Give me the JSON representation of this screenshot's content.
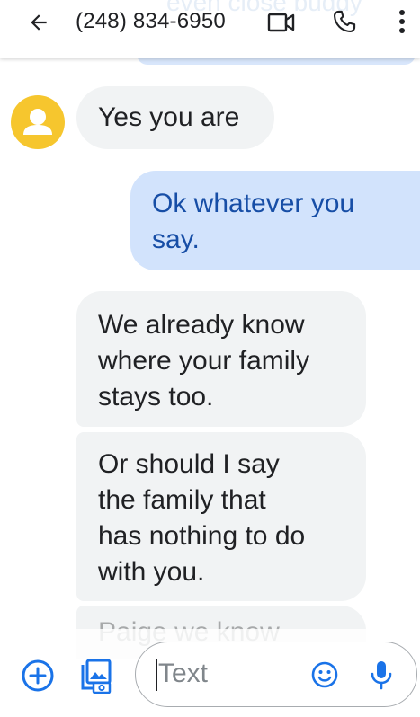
{
  "header": {
    "title": "(248) 834-6950",
    "back_icon": "arrow-back-icon",
    "video_icon": "videocam-icon",
    "call_icon": "phone-icon",
    "more_icon": "more-vert-icon",
    "partial_previous_message": "even close buddy"
  },
  "messages": [
    {
      "direction": "incoming",
      "text": "Yes you are"
    },
    {
      "direction": "outgoing",
      "text": "Ok whatever you\nsay."
    },
    {
      "direction": "incoming",
      "text": "We already know\nwhere your family\nstays too."
    },
    {
      "direction": "incoming",
      "text": "Or should I say\nthe family that\nhas nothing to do\nwith you."
    },
    {
      "direction": "incoming",
      "text": "Paige we know"
    }
  ],
  "compose": {
    "placeholder": "Text",
    "add_icon": "add-circle-icon",
    "gallery_icon": "gallery-icon",
    "emoji_icon": "emoji-icon",
    "mic_icon": "mic-icon"
  },
  "colors": {
    "accent": "#1a73e8",
    "outgoing_bubble": "#d2e3fc",
    "incoming_bubble": "#f1f3f4",
    "avatar": "#f6c62e"
  }
}
